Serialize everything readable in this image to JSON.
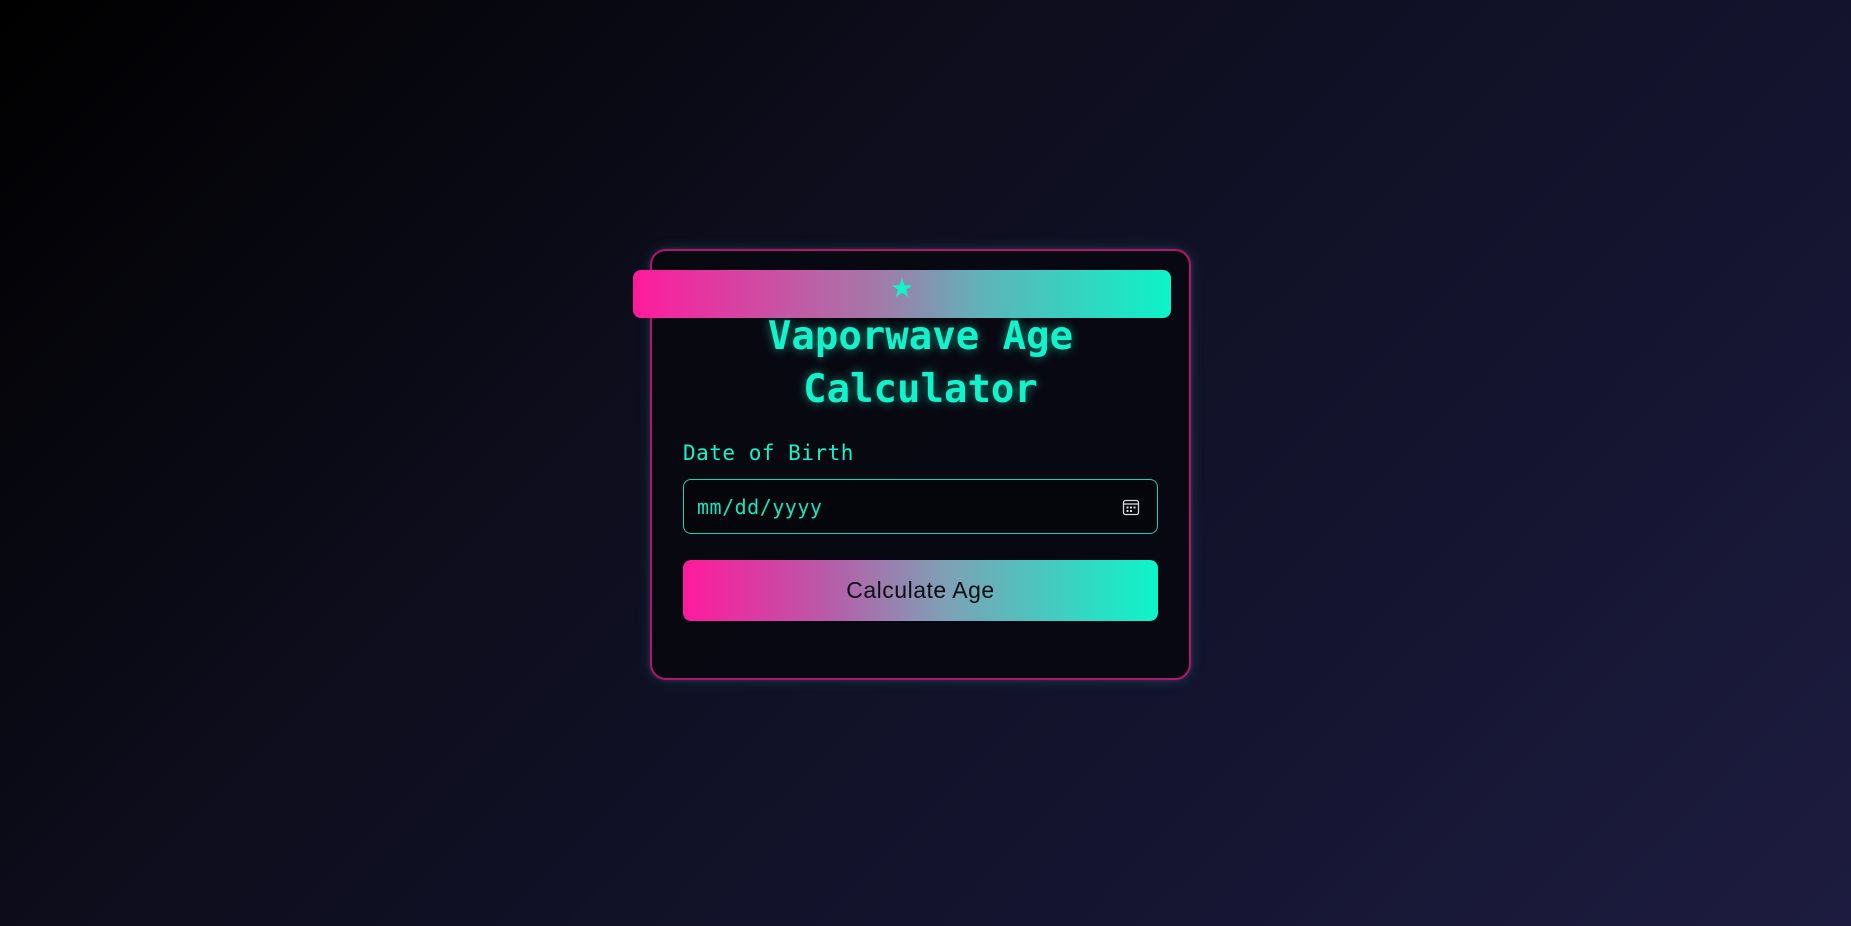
{
  "app": {
    "title": "Vaporwave Age Calculator"
  },
  "banner": {
    "icon": "star-icon"
  },
  "form": {
    "dob_label": "Date of Birth",
    "dob_placeholder": "mm/dd/yyyy",
    "dob_icon": "calendar-icon",
    "submit_label": "Calculate Age"
  },
  "colors": {
    "accent_cyan": "#12f3cb",
    "accent_pink": "#ff1a9d",
    "card_border": "#b0166a",
    "background_dark": "#000000",
    "background_light": "#1d1c40"
  }
}
